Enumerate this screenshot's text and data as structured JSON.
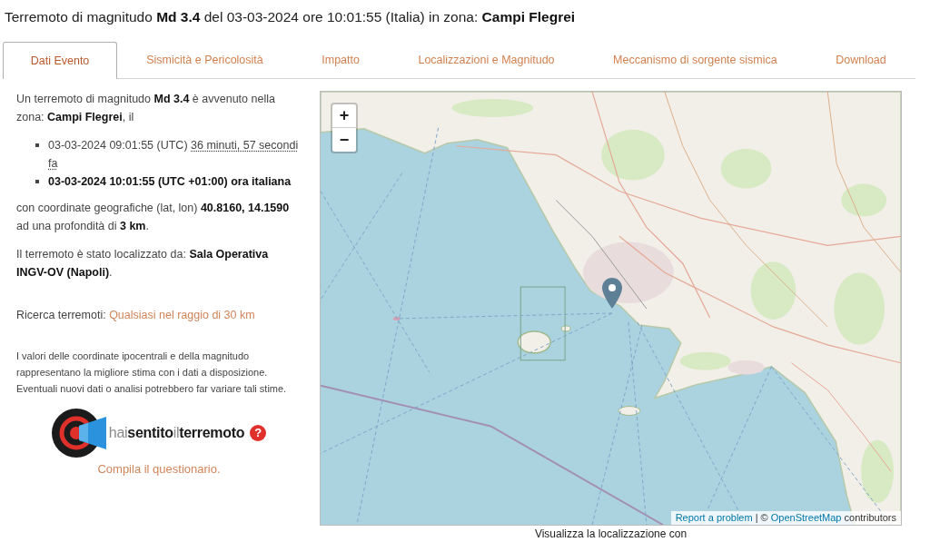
{
  "title": "Terremoto di magnitudo **Md 3.4** del 03-03-2024 ore 10:01:55 (Italia) in zona: **Campi Flegrei**",
  "tabs": [
    {
      "label": "Dati Evento",
      "selected": true
    },
    {
      "label": "Sismicità e Pericolosità",
      "selected": false
    },
    {
      "label": "Impatto",
      "selected": false
    },
    {
      "label": "Localizzazioni e Magnitudo",
      "selected": false
    },
    {
      "label": "Meccanismo di sorgente sismica",
      "selected": false
    },
    {
      "label": "Download",
      "selected": false
    }
  ],
  "summary": {
    "intro": "Un terremoto di magnitudo **Md 3.4** è avvenuto nella zona: **Campi Flegrei**, il",
    "times": [
      {
        "time": "03-03-2024 09:01:55 (UTC)",
        "relative": "36 minuti, 57 secondi fa",
        "bold": false
      },
      {
        "time": "03-03-2024 10:01:55 (UTC +01:00) ora italiana",
        "bold": true
      }
    ],
    "coordinates": "con coordinate geografiche (lat, lon) **40.8160, 14.1590** ad una profondità di **3 km**.",
    "located_by": "Il terremoto è stato localizzato da: **Sala Operativa INGV-OV (Napoli)**.",
    "search": {
      "label": "Ricerca terremoti:",
      "link": "Qualsiasi nel raggio di 30 km"
    },
    "disclaimer": "I valori delle coordinate ipocentrali e della magnitudo rappresentano la migliore stima con i dati a disposizione. Eventuali nuovi dati o analisi potrebbero far variare tali stime."
  },
  "survey": {
    "logo_text": "hai**sentito**il**terremoto**",
    "help_mark": "?",
    "link": "Compila il questionario."
  },
  "map": {
    "zoom_in": "+",
    "zoom_out": "−",
    "attribution": {
      "report_link": "Report a problem",
      "separator": "| ©",
      "osm_link": "OpenStreetMap",
      "suffix": "contributors"
    }
  },
  "map_caption": "Visualizza la localizzazione con"
}
